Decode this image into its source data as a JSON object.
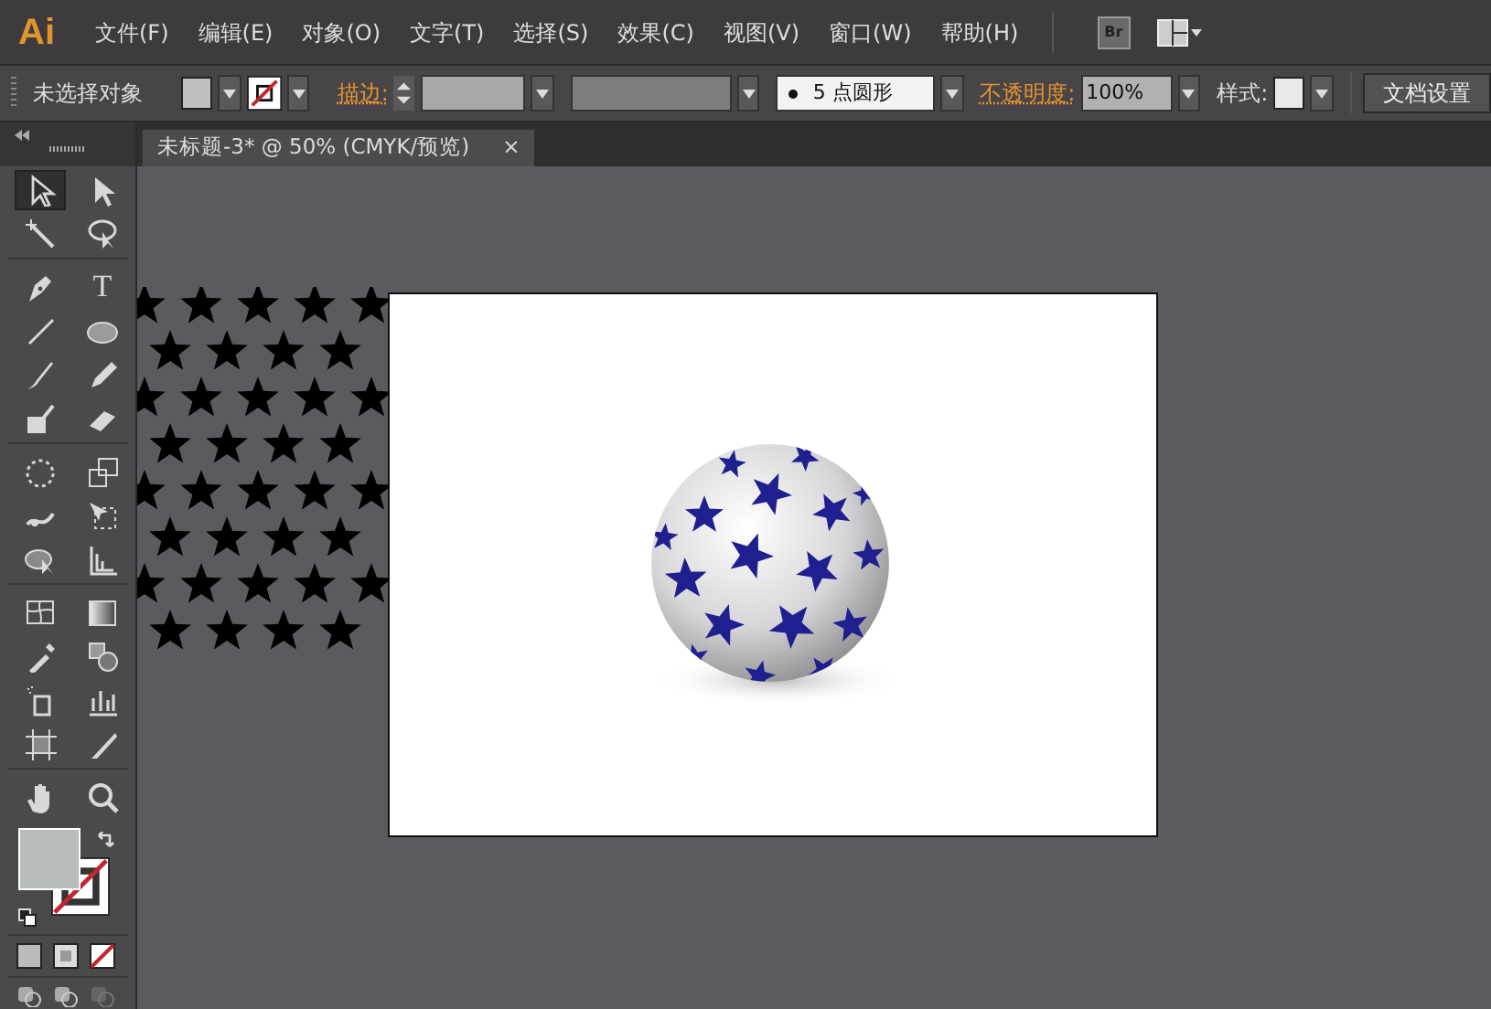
{
  "app_logo": "Ai",
  "menu": [
    "文件(F)",
    "编辑(E)",
    "对象(O)",
    "文字(T)",
    "选择(S)",
    "效果(C)",
    "视图(V)",
    "窗口(W)",
    "帮助(H)"
  ],
  "bridge_button": "Br",
  "control_bar": {
    "selection": "未选择对象",
    "stroke_label": "描边:",
    "brush": "5 点圆形",
    "opacity_label": "不透明度:",
    "opacity": "100%",
    "style_label": "样式:",
    "document_setup": "文档设置"
  },
  "document_tab": {
    "title": "未标题-3* @ 50% (CMYK/预览)",
    "close": "×"
  },
  "tools": [
    {
      "kind": "select",
      "selected": true
    },
    {
      "kind": "direct",
      "selected": false
    },
    {
      "kind": "wand",
      "selected": false
    },
    {
      "kind": "lasso",
      "selected": false
    },
    {
      "kind": "pen",
      "selected": false
    },
    {
      "kind": "type",
      "label": "T",
      "selected": false
    },
    {
      "kind": "line",
      "selected": false
    },
    {
      "kind": "ellipse",
      "selected": false
    },
    {
      "kind": "brush",
      "selected": false
    },
    {
      "kind": "pencil",
      "selected": false
    },
    {
      "kind": "blob",
      "selected": false
    },
    {
      "kind": "eraser",
      "selected": false
    },
    {
      "kind": "rotate",
      "selected": false
    },
    {
      "kind": "scale",
      "selected": false
    },
    {
      "kind": "warp",
      "selected": false
    },
    {
      "kind": "transform",
      "selected": false
    },
    {
      "kind": "builder",
      "selected": false
    },
    {
      "kind": "perspective",
      "selected": false
    },
    {
      "kind": "mesh",
      "selected": false
    },
    {
      "kind": "gradient",
      "selected": false
    },
    {
      "kind": "eyedropper",
      "selected": false
    },
    {
      "kind": "blend",
      "selected": false
    },
    {
      "kind": "sprayer",
      "selected": false
    },
    {
      "kind": "graph",
      "selected": false
    },
    {
      "kind": "artboard",
      "selected": false
    },
    {
      "kind": "slice",
      "selected": false
    },
    {
      "kind": "hand",
      "selected": false
    },
    {
      "kind": "zoom",
      "selected": false
    }
  ]
}
